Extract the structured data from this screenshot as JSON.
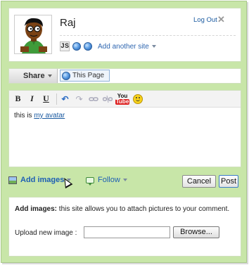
{
  "profile": {
    "username": "Raj",
    "logout_label": "Log Out",
    "close_glyph": "✕",
    "site_badge": "JS",
    "add_site_label": "Add another site"
  },
  "share": {
    "share_label": "Share",
    "scope_label": "This Page"
  },
  "toolbar": {
    "bold": "B",
    "italic": "I",
    "underline": "U",
    "undo": "↶",
    "redo": "↷",
    "youtube_top": "You",
    "youtube_bottom": "Tube",
    "icons": [
      "bold-icon",
      "italic-icon",
      "underline-icon",
      "undo-icon",
      "redo-icon",
      "link-icon",
      "unlink-icon",
      "youtube-icon",
      "smiley-icon"
    ]
  },
  "comment": {
    "text_prefix": "this is ",
    "link_text": "my avatar"
  },
  "actions": {
    "add_images_label": "Add images",
    "follow_label": "Follow",
    "cancel_label": "Cancel",
    "post_label": "Post"
  },
  "upload": {
    "heading": "Add images:",
    "description": " this site allows you to attach pictures to your comment.",
    "field_label": "Upload new image :",
    "field_value": "",
    "browse_label": "Browse..."
  },
  "colors": {
    "background": "#c8e6a8",
    "link": "#1a5aa0",
    "post_border": "#3b7bc8"
  }
}
